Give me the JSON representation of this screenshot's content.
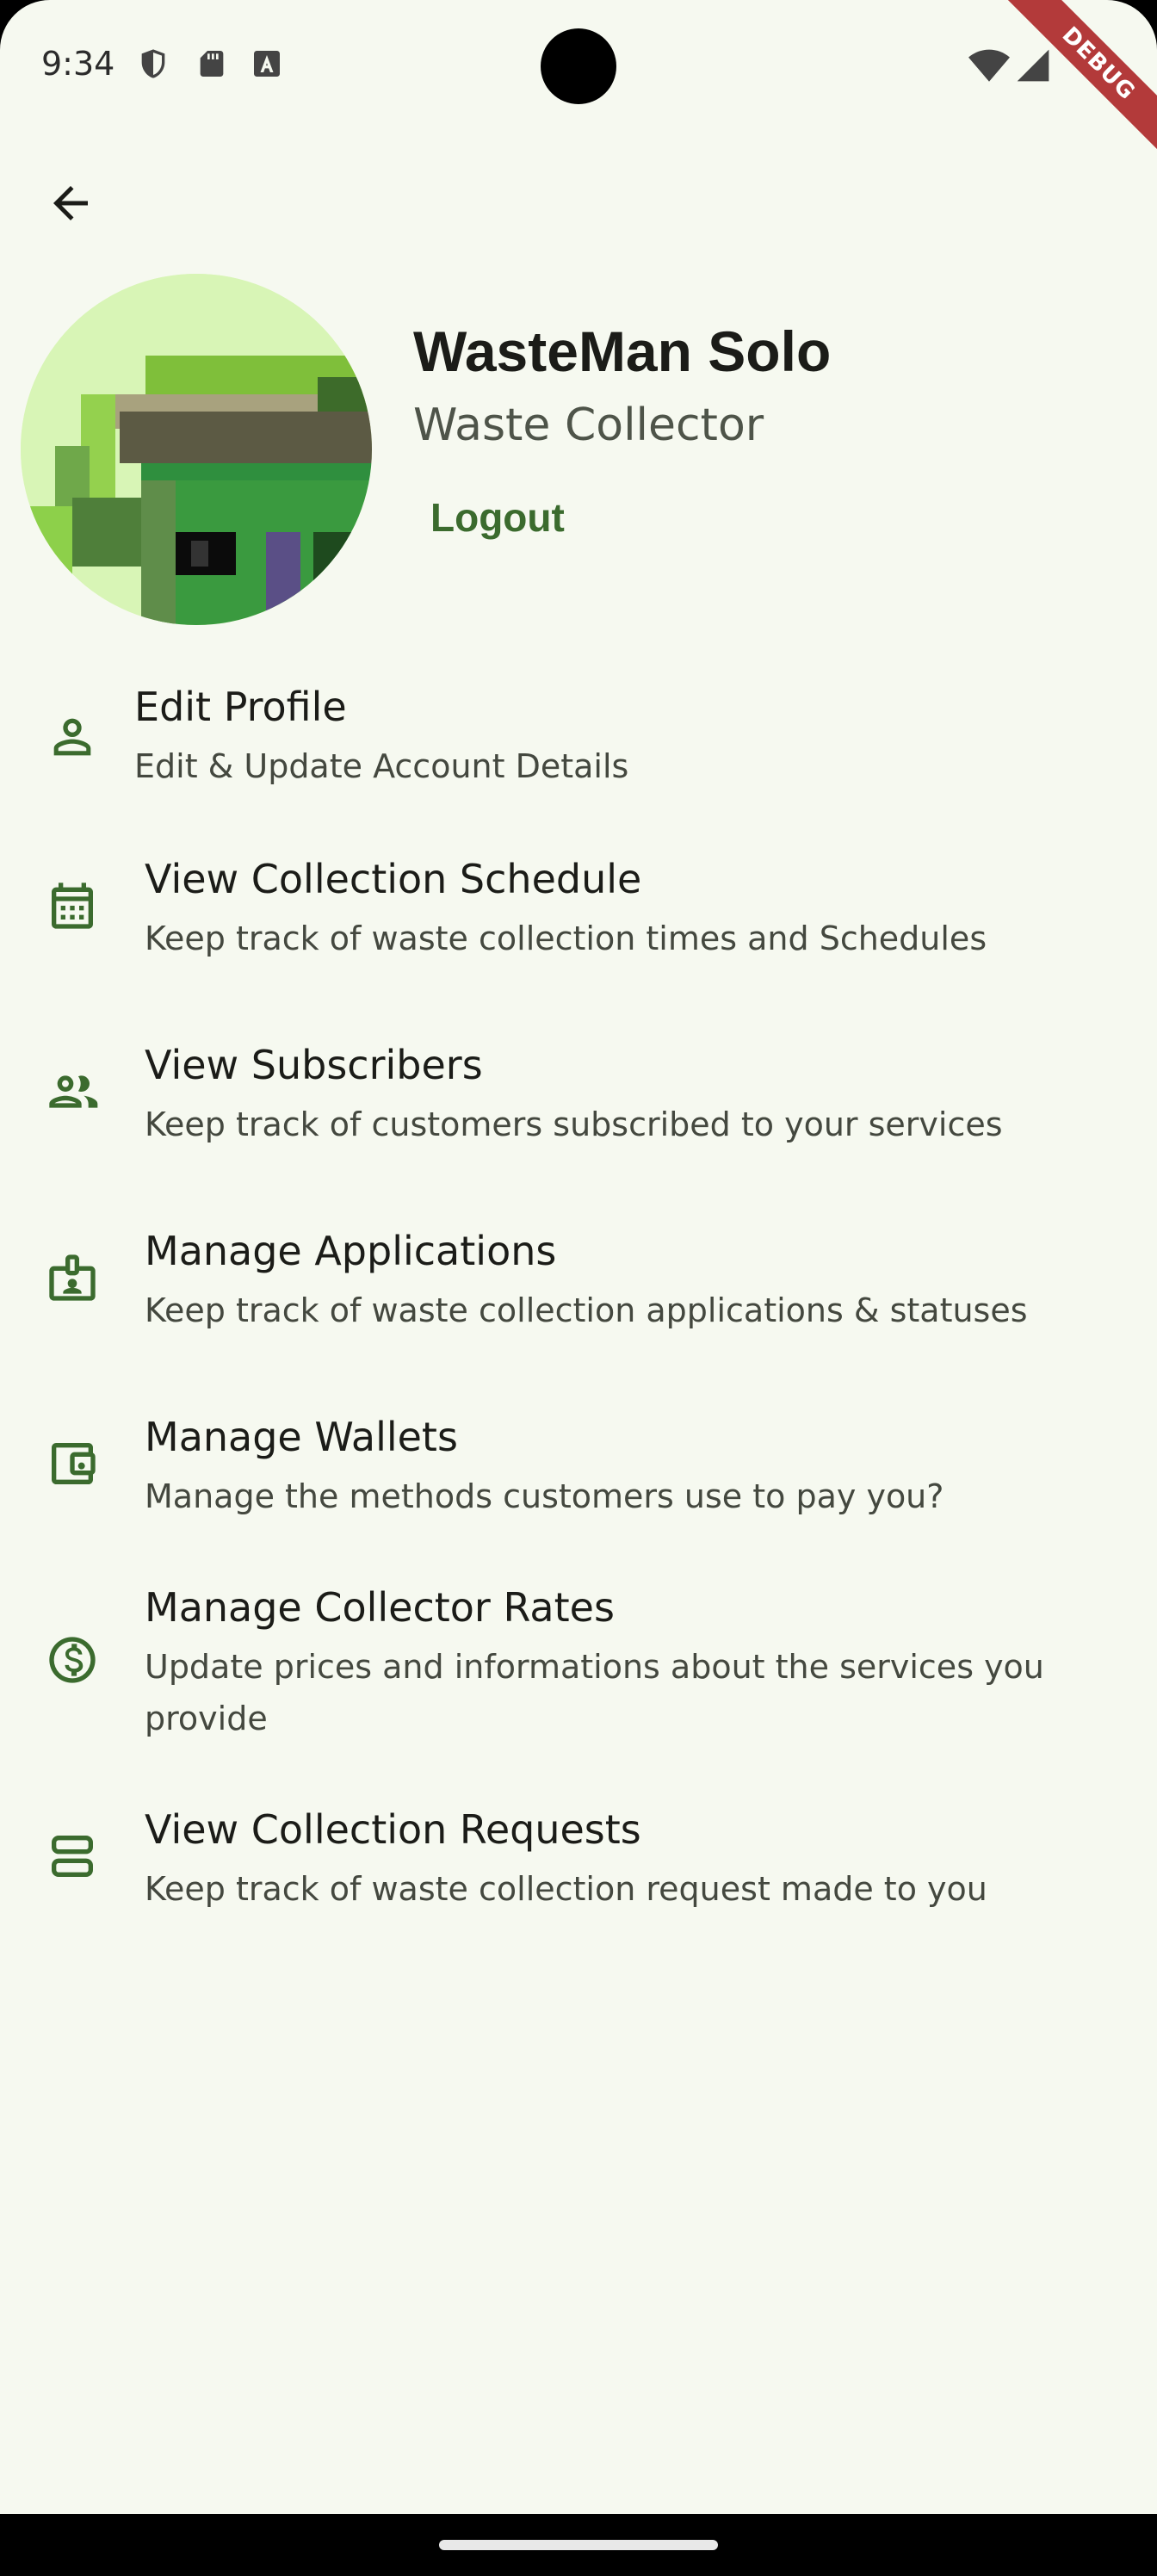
{
  "status_bar": {
    "time": "9:34",
    "debug_label": "DEBUG"
  },
  "profile": {
    "name": "WasteMan Solo",
    "role": "Waste Collector",
    "logout_label": "Logout"
  },
  "menu": [
    {
      "title": "Edit Profile",
      "subtitle": "Edit & Update Account Details",
      "icon": "person-icon"
    },
    {
      "title": "View Collection Schedule",
      "subtitle": "Keep track of waste collection times and Schedules",
      "icon": "calendar-icon"
    },
    {
      "title": "View Subscribers",
      "subtitle": "Keep track of customers subscribed to your services",
      "icon": "people-icon"
    },
    {
      "title": "Manage Applications",
      "subtitle": "Keep track of waste collection applications & statuses",
      "icon": "badge-icon"
    },
    {
      "title": "Manage Wallets",
      "subtitle": "Manage the methods customers use to pay you?",
      "icon": "wallet-icon"
    },
    {
      "title": "Manage Collector Rates",
      "subtitle": "Update prices and informations about the services you provide",
      "icon": "dollar-icon"
    },
    {
      "title": "View Collection Requests",
      "subtitle": "Keep track of waste collection request made to you",
      "icon": "storage-icon"
    }
  ],
  "colors": {
    "accent": "#3b6b2e",
    "background": "#f6f9f0",
    "icon": "#3b6b2e"
  }
}
